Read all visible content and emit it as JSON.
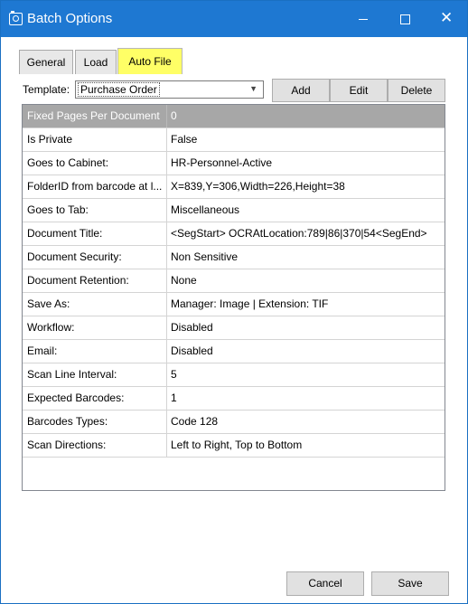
{
  "window": {
    "title": "Batch Options"
  },
  "tabs": [
    {
      "label": "General"
    },
    {
      "label": "Load"
    },
    {
      "label": "Auto File"
    }
  ],
  "template": {
    "label": "Template:",
    "value": "Purchase Order"
  },
  "toolbar": {
    "add_label": "Add",
    "edit_label": "Edit",
    "delete_label": "Delete"
  },
  "grid": {
    "rows": [
      {
        "name": "Fixed Pages Per Document",
        "value": "0"
      },
      {
        "name": "Is Private",
        "value": "False"
      },
      {
        "name": "Goes to Cabinet:",
        "value": "HR-Personnel-Active"
      },
      {
        "name": "FolderID from barcode at l...",
        "value": "X=839,Y=306,Width=226,Height=38"
      },
      {
        "name": "Goes to Tab:",
        "value": "Miscellaneous"
      },
      {
        "name": "Document Title:",
        "value": "<SegStart> OCRAtLocation:789|86|370|54<SegEnd>"
      },
      {
        "name": "Document Security:",
        "value": "Non Sensitive"
      },
      {
        "name": "Document Retention:",
        "value": "None"
      },
      {
        "name": "Save As:",
        "value": "Manager: Image | Extension: TIF"
      },
      {
        "name": "Workflow:",
        "value": "Disabled"
      },
      {
        "name": "Email:",
        "value": "Disabled"
      },
      {
        "name": "Scan Line Interval:",
        "value": "5"
      },
      {
        "name": "Expected Barcodes:",
        "value": "1"
      },
      {
        "name": "Barcodes Types:",
        "value": "Code 128"
      },
      {
        "name": "Scan Directions:",
        "value": "Left to Right, Top to Bottom"
      }
    ]
  },
  "footer": {
    "cancel_label": "Cancel",
    "save_label": "Save"
  },
  "colors": {
    "titlebar": "#1e78d2",
    "active_tab": "#ffff66",
    "selected_row": "#a7a7a7"
  }
}
